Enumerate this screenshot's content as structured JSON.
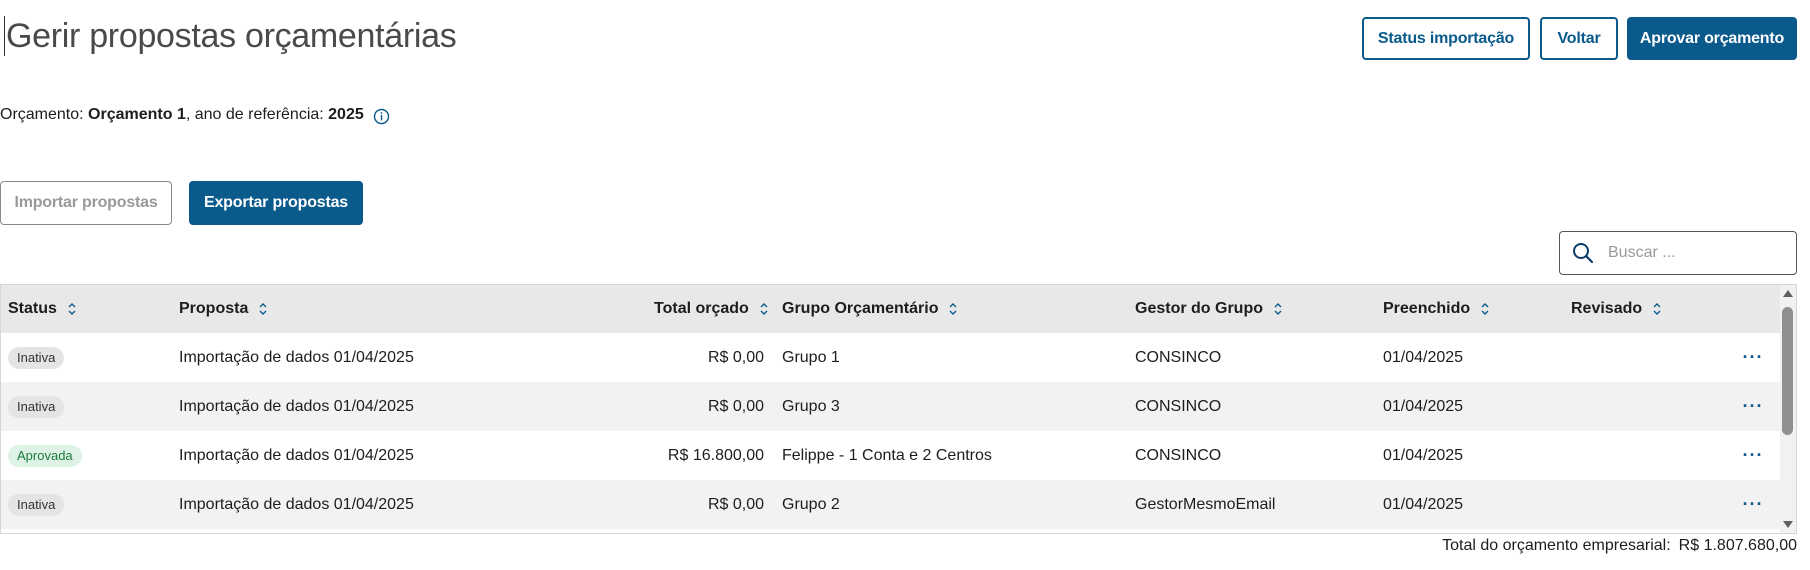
{
  "header": {
    "title": "Gerir propostas orçamentárias",
    "status_import_label": "Status importação",
    "back_label": "Voltar",
    "approve_label": "Aprovar orçamento"
  },
  "budget_info": {
    "prefix": "Orçamento: ",
    "budget_name": "Orçamento 1",
    "middle": ", ano de referência: ",
    "year": "2025",
    "info_icon": "info-circle-icon"
  },
  "actions": {
    "import_label": "Importar propostas",
    "export_label": "Exportar propostas"
  },
  "search": {
    "placeholder": "Buscar ...",
    "value": "",
    "icon": "search-icon"
  },
  "table": {
    "columns": [
      "Status",
      "Proposta",
      "Total orçado",
      "Grupo Orçamentário",
      "Gestor do Grupo",
      "Preenchido",
      "Revisado"
    ],
    "rows": [
      {
        "status": "Inativa",
        "status_type": "inativa",
        "proposta": "Importação de dados 01/04/2025",
        "total": "R$ 0,00",
        "grupo": "Grupo 1",
        "gestor": "CONSINCO",
        "preenchido": "01/04/2025",
        "revisado": "",
        "menu": "···"
      },
      {
        "status": "Inativa",
        "status_type": "inativa",
        "proposta": "Importação de dados 01/04/2025",
        "total": "R$ 0,00",
        "grupo": "Grupo 3",
        "gestor": "CONSINCO",
        "preenchido": "01/04/2025",
        "revisado": "",
        "menu": "···"
      },
      {
        "status": "Aprovada",
        "status_type": "aprovada",
        "proposta": "Importação de dados 01/04/2025",
        "total": "R$ 16.800,00",
        "grupo": "Felippe - 1 Conta e 2 Centros",
        "gestor": "CONSINCO",
        "preenchido": "01/04/2025",
        "revisado": "",
        "menu": "···"
      },
      {
        "status": "Inativa",
        "status_type": "inativa",
        "proposta": "Importação de dados 01/04/2025",
        "total": "R$ 0,00",
        "grupo": "Grupo 2",
        "gestor": "GestorMesmoEmail",
        "preenchido": "01/04/2025",
        "revisado": "",
        "menu": "···"
      }
    ]
  },
  "footer": {
    "total_label": "Total do orçamento empresarial:",
    "total_value": "R$ 1.807.680,00"
  },
  "colors": {
    "primary": "#0b5a8c",
    "approved_badge_bg": "#def3e6",
    "approved_badge_text": "#1a7a3e",
    "inactive_badge_bg": "#e4e4e4"
  }
}
